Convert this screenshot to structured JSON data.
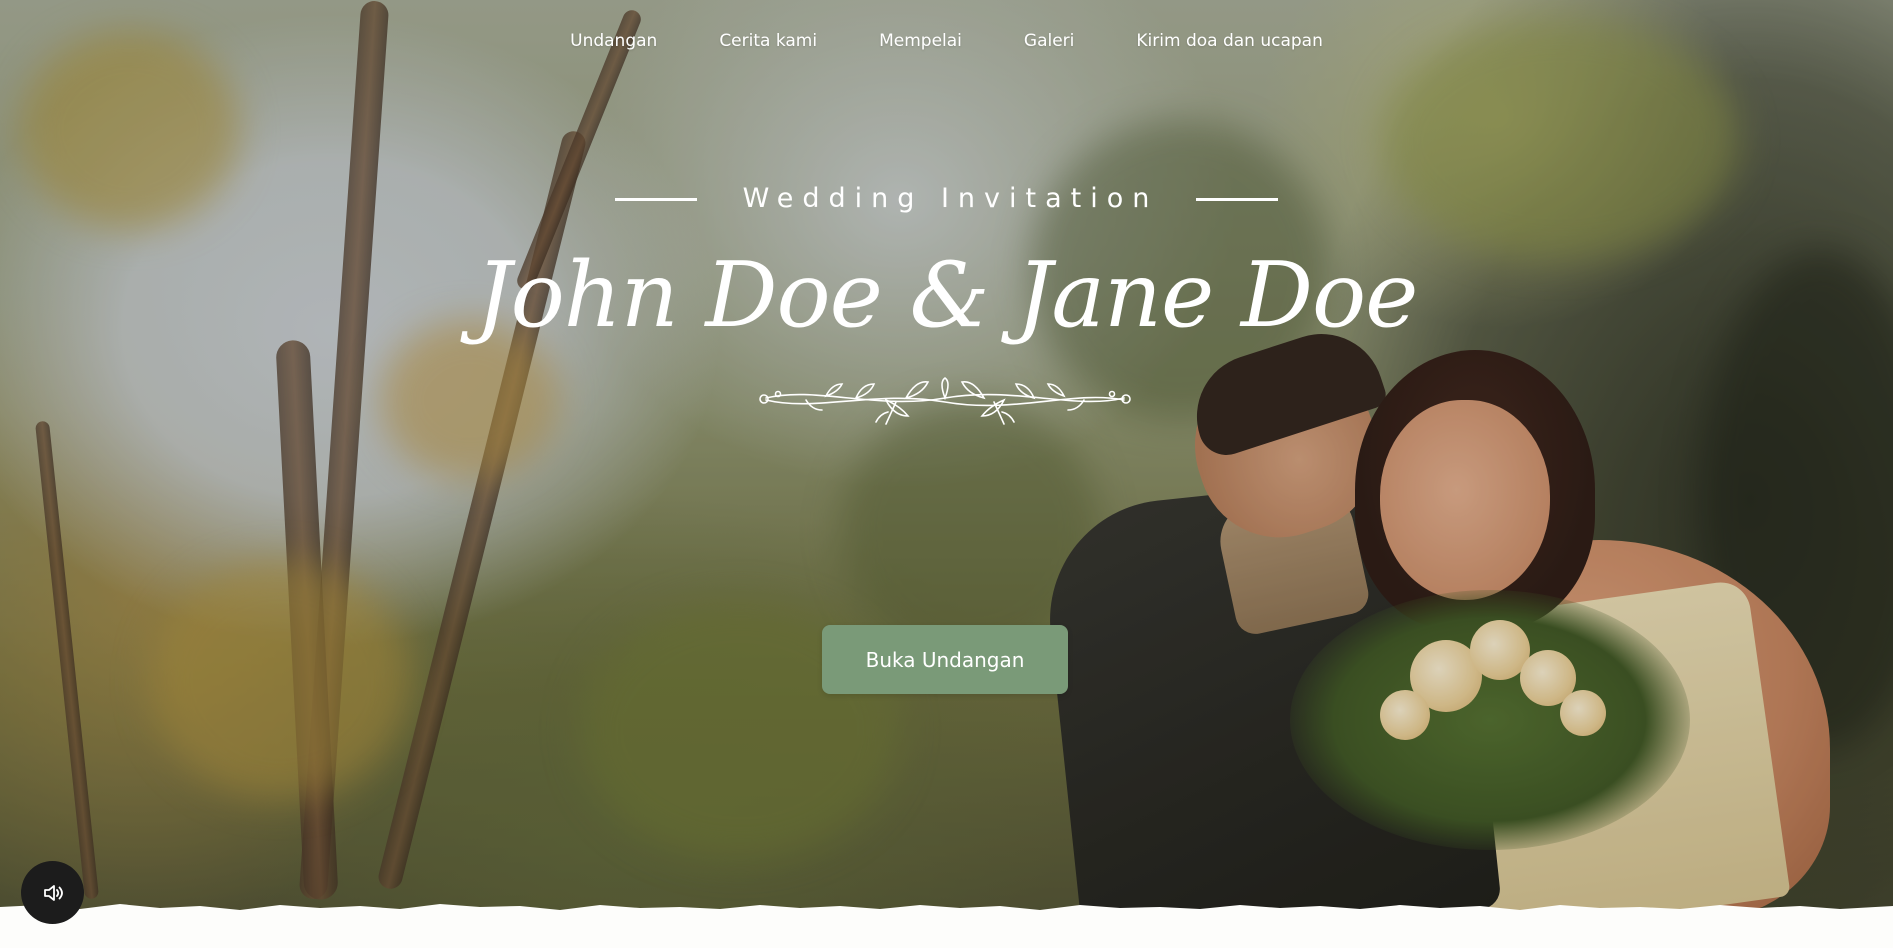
{
  "nav": {
    "items": [
      {
        "label": "Undangan"
      },
      {
        "label": "Cerita kami"
      },
      {
        "label": "Mempelai"
      },
      {
        "label": "Galeri"
      },
      {
        "label": "Kirim doa dan ucapan"
      }
    ]
  },
  "hero": {
    "subtitle": "Wedding Invitation",
    "couple_names": "John Doe & Jane Doe",
    "open_button_label": "Buka Undangan",
    "button_color": "#7a9a78",
    "sound_icon": "speaker-icon"
  }
}
